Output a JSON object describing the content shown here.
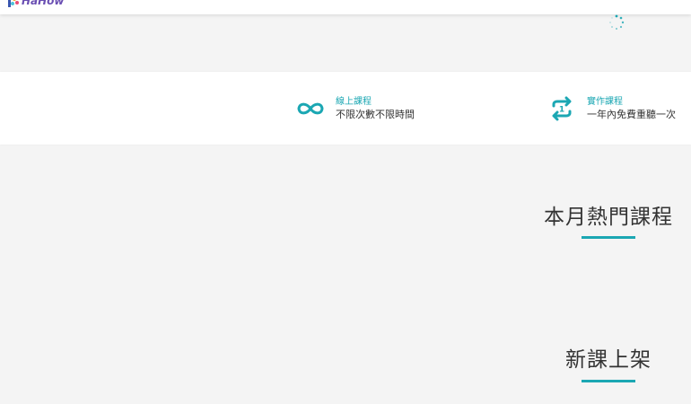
{
  "header": {
    "logo_text": "HaHow",
    "brand_color": "#6a4fb3",
    "accent_color": "#1ba7b3"
  },
  "loading": {
    "icon": "spinner-icon"
  },
  "features": [
    {
      "icon": "infinity-icon",
      "title": "線上課程",
      "desc": "不限次數不限時間"
    },
    {
      "icon": "repeat-icon",
      "title": "實作課程",
      "desc": "一年內免費重聽一次"
    }
  ],
  "sections": {
    "hot_courses": "本月熱門課程",
    "new_courses": "新課上架"
  }
}
